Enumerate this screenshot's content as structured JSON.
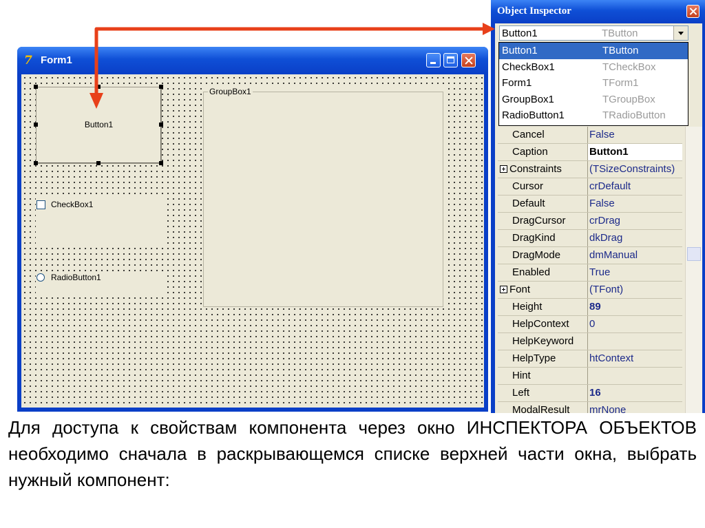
{
  "form_window": {
    "title": "Form1",
    "logo": "7",
    "title_buttons": [
      "minimize-icon",
      "maximize-icon",
      "close-icon"
    ],
    "button1_caption": "Button1",
    "checkbox_label": "CheckBox1",
    "radio_label": "RadioButton1",
    "groupbox_label": "GroupBox1"
  },
  "object_inspector": {
    "title": "Object Inspector",
    "combo": {
      "name": "Button1",
      "type": "TButton"
    },
    "list": [
      {
        "name": "Button1",
        "type": "TButton",
        "selected": true
      },
      {
        "name": "CheckBox1",
        "type": "TCheckBox"
      },
      {
        "name": "Form1",
        "type": "TForm1"
      },
      {
        "name": "GroupBox1",
        "type": "TGroupBox"
      },
      {
        "name": "RadioButton1",
        "type": "TRadioButton"
      }
    ],
    "properties": [
      {
        "name": "Cancel",
        "value": "False"
      },
      {
        "name": "Caption",
        "value": "Button1",
        "bold": true,
        "active": true
      },
      {
        "name": "Constraints",
        "value": "(TSizeConstraints)",
        "expandable": true
      },
      {
        "name": "Cursor",
        "value": "crDefault"
      },
      {
        "name": "Default",
        "value": "False"
      },
      {
        "name": "DragCursor",
        "value": "crDrag"
      },
      {
        "name": "DragKind",
        "value": "dkDrag"
      },
      {
        "name": "DragMode",
        "value": "dmManual"
      },
      {
        "name": "Enabled",
        "value": "True"
      },
      {
        "name": "Font",
        "value": "(TFont)",
        "expandable": true
      },
      {
        "name": "Height",
        "value": "89",
        "bold": true
      },
      {
        "name": "HelpContext",
        "value": "0"
      },
      {
        "name": "HelpKeyword",
        "value": ""
      },
      {
        "name": "HelpType",
        "value": "htContext"
      },
      {
        "name": "Hint",
        "value": ""
      },
      {
        "name": "Left",
        "value": "16",
        "bold": true
      },
      {
        "name": "ModalResult",
        "value": "mrNone"
      }
    ]
  },
  "caption": "Для доступа к свойствам компонента через окно ИНСПЕКТОРА ОБЪЕКТОВ необходимо сначала в раскрывающемся списке верхней части окна, выбрать нужный компонент:",
  "colors": {
    "xp_title_blue": "#0a3fc7",
    "selection_blue": "#316ac5",
    "arrow_red": "#e8401a",
    "value_navy": "#1c2a8a"
  }
}
